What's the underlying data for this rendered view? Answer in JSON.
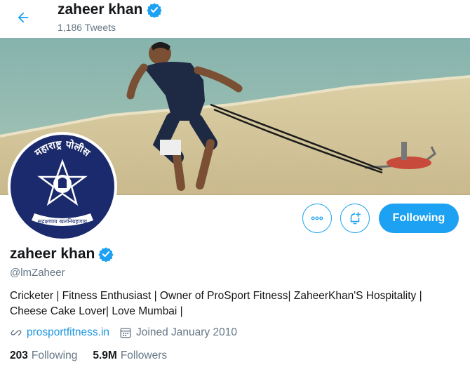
{
  "header": {
    "name": "zaheer khan",
    "tweet_count": "1,186 Tweets",
    "back_icon": "arrow-left-icon"
  },
  "profile": {
    "name": "zaheer khan",
    "handle": "@lmZaheer",
    "verified_icon": "verified-badge-icon",
    "bio": "Cricketer | Fitness Enthusiast | Owner of ProSport Fitness| ZaheerKhan'S Hospitality | Cheese Cake Lover| Love Mumbai |",
    "website": "prosportfitness.in",
    "joined": "Joined January 2010",
    "following_count": "203",
    "following_label": "Following",
    "followers_count": "5.9M",
    "followers_label": "Followers",
    "avatar_text_top": "महाराष्ट्र पोलीस",
    "avatar_text_bottom": "सद्रक्षणाय खलनिग्रहणाय"
  },
  "actions": {
    "more_icon": "more-horizontal-icon",
    "notify_icon": "bell-plus-icon",
    "follow_label": "Following"
  },
  "colors": {
    "accent": "#1da1f2",
    "text_secondary": "#657786",
    "avatar_bg": "#1a2a6c"
  }
}
